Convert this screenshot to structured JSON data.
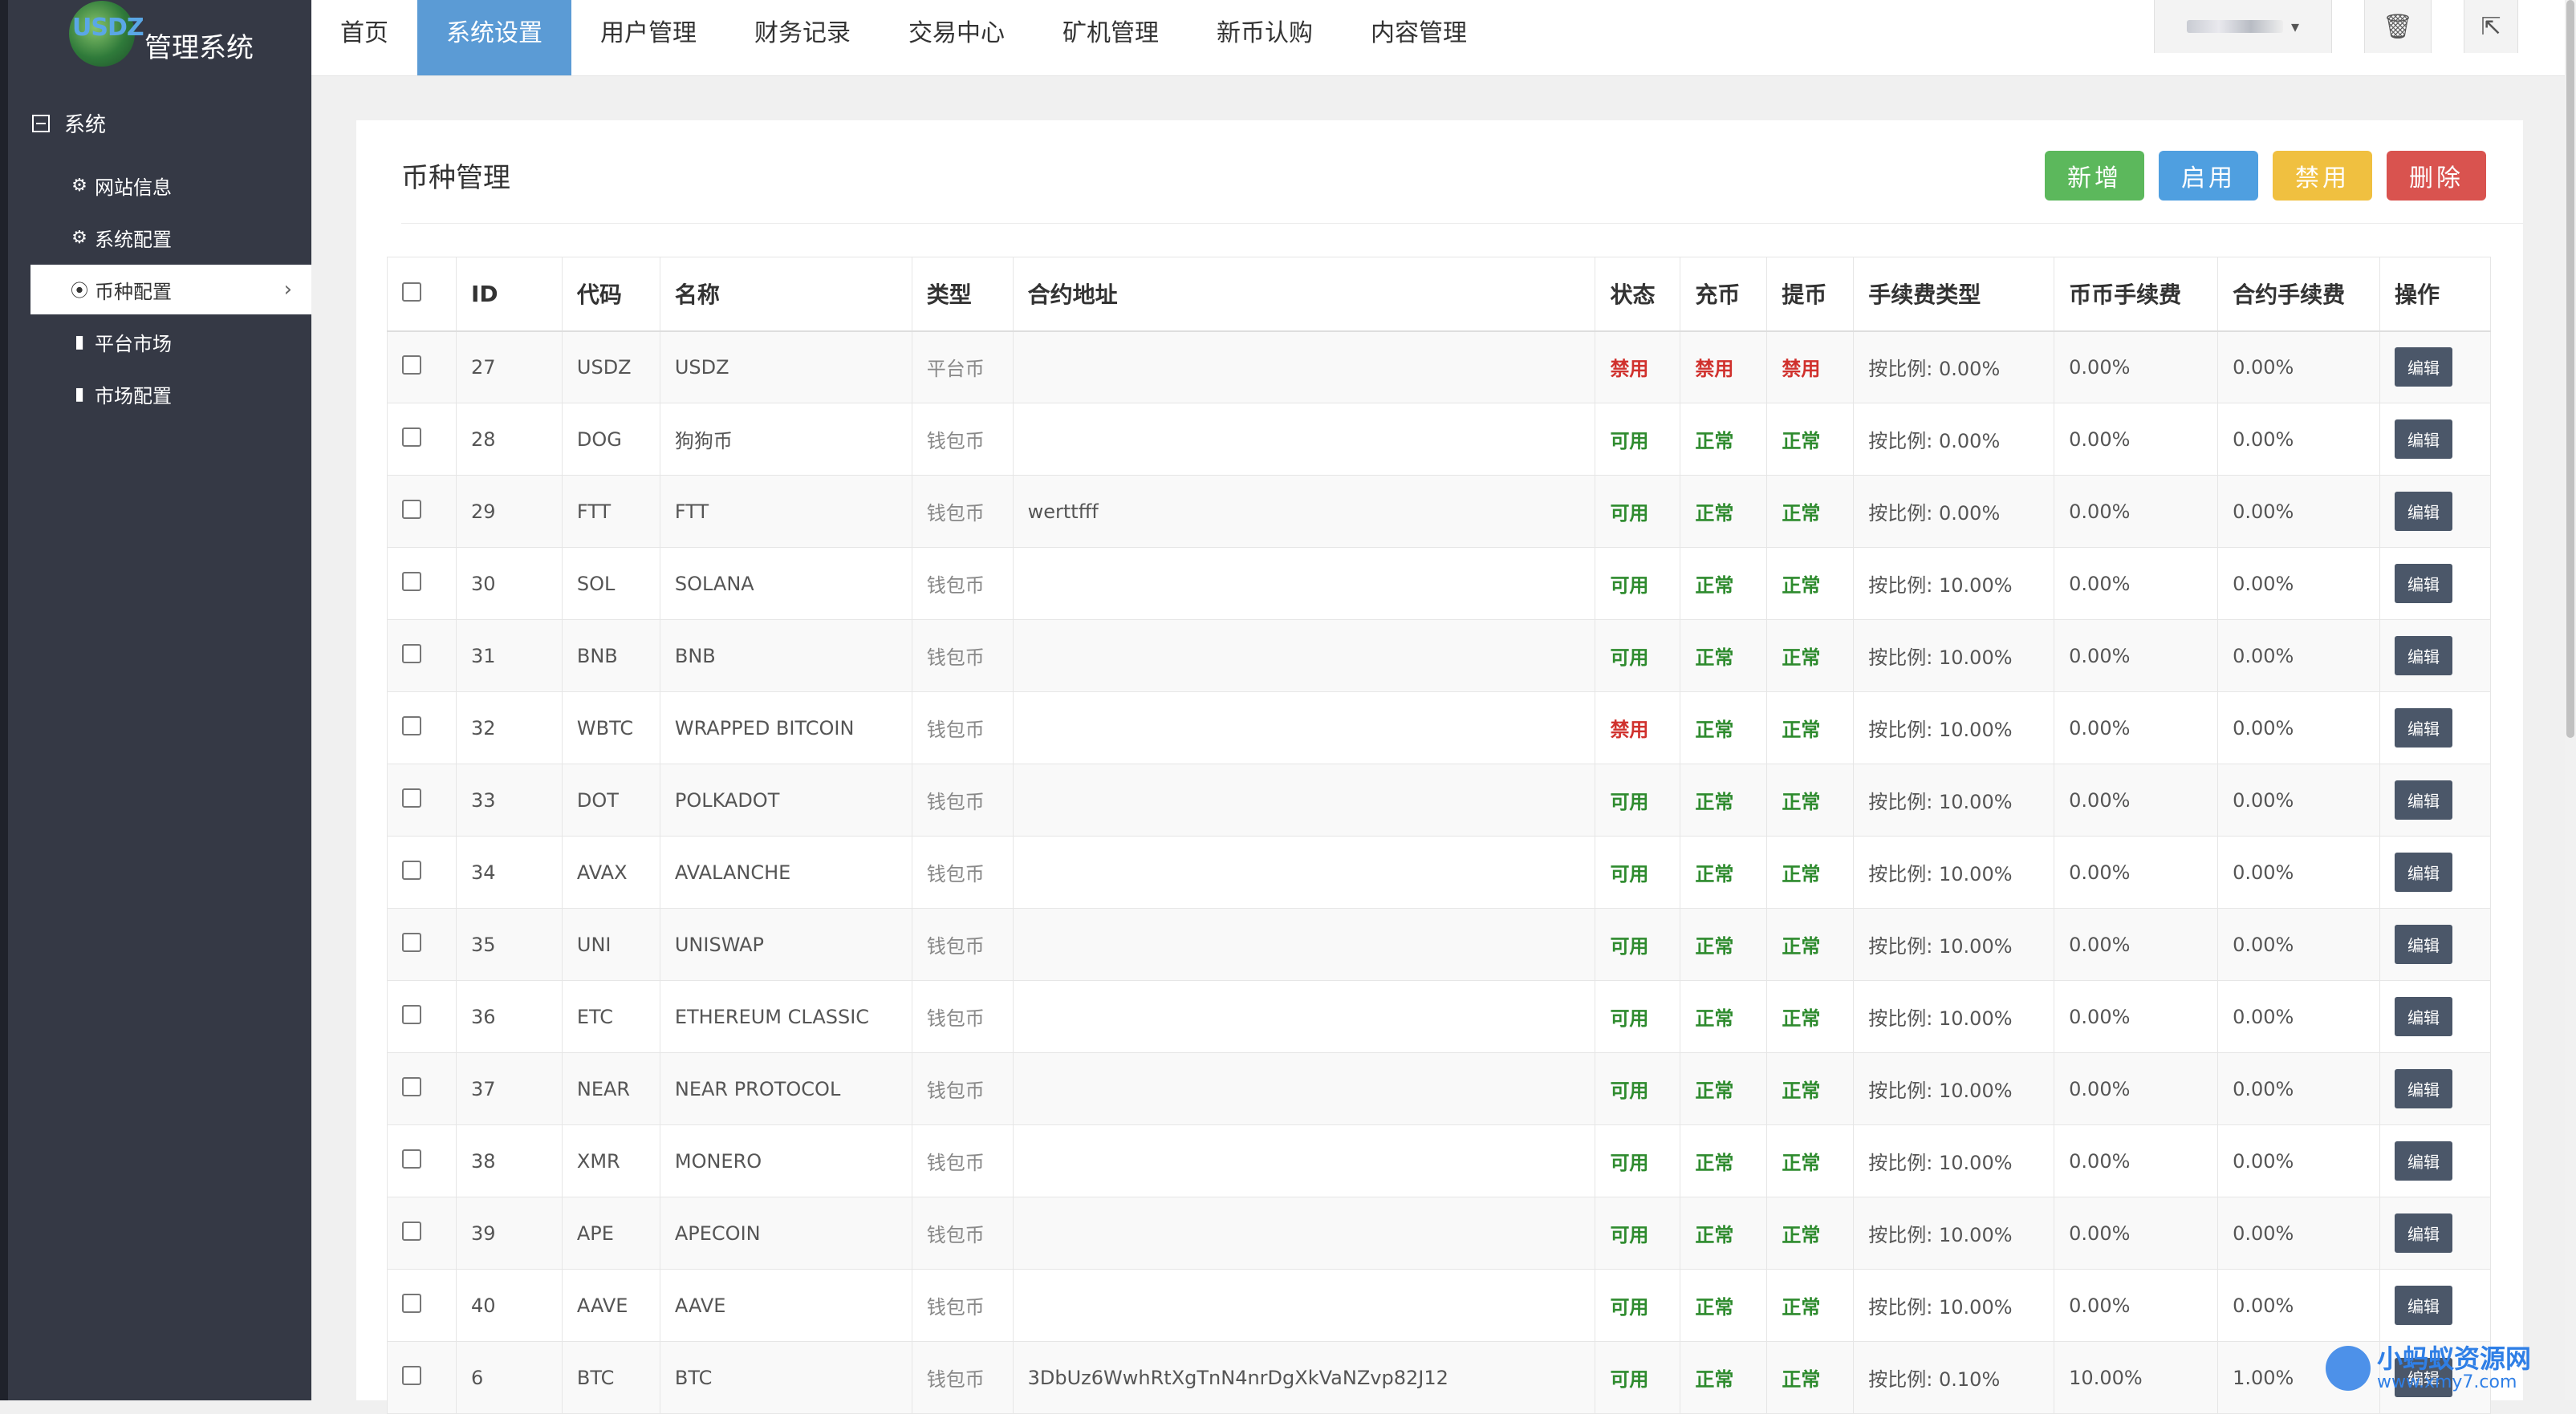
{
  "app": {
    "logo_text": "USDZ",
    "title": "管理系统"
  },
  "nav": {
    "items": [
      {
        "label": "首页",
        "active": false
      },
      {
        "label": "系统设置",
        "active": true
      },
      {
        "label": "用户管理",
        "active": false
      },
      {
        "label": "财务记录",
        "active": false
      },
      {
        "label": "交易中心",
        "active": false
      },
      {
        "label": "矿机管理",
        "active": false
      },
      {
        "label": "新币认购",
        "active": false
      },
      {
        "label": "内容管理",
        "active": false
      }
    ]
  },
  "topright": {
    "trash_icon": "trash-icon",
    "exit_icon": "exit-icon"
  },
  "sidebar": {
    "group": "系统",
    "items": [
      {
        "label": "网站信息",
        "icon": "gear-icon",
        "active": false
      },
      {
        "label": "系统配置",
        "icon": "gear-icon",
        "active": false
      },
      {
        "label": "币种配置",
        "icon": "dot-circle-icon",
        "active": true
      },
      {
        "label": "平台市场",
        "icon": "bar-chart-icon",
        "active": false
      },
      {
        "label": "市场配置",
        "icon": "bar-chart-icon",
        "active": false
      }
    ]
  },
  "panel": {
    "title": "币种管理",
    "actions": {
      "add": "新增",
      "enable": "启用",
      "disable": "禁用",
      "delete": "删除"
    }
  },
  "table": {
    "headers": [
      "ID",
      "代码",
      "名称",
      "类型",
      "合约地址",
      "状态",
      "充币",
      "提币",
      "手续费类型",
      "币币手续费",
      "合约手续费",
      "操作"
    ],
    "edit_label": "编辑",
    "rows": [
      [
        "27",
        "USDZ",
        "USDZ",
        "平台币",
        "",
        "禁用",
        "禁用",
        "禁用",
        "按比例: 0.00%",
        "0.00%",
        "0.00%"
      ],
      [
        "28",
        "DOG",
        "狗狗币",
        "钱包币",
        "",
        "可用",
        "正常",
        "正常",
        "按比例: 0.00%",
        "0.00%",
        "0.00%"
      ],
      [
        "29",
        "FTT",
        "FTT",
        "钱包币",
        "werttfff",
        "可用",
        "正常",
        "正常",
        "按比例: 0.00%",
        "0.00%",
        "0.00%"
      ],
      [
        "30",
        "SOL",
        "SOLANA",
        "钱包币",
        "",
        "可用",
        "正常",
        "正常",
        "按比例: 10.00%",
        "0.00%",
        "0.00%"
      ],
      [
        "31",
        "BNB",
        "BNB",
        "钱包币",
        "",
        "可用",
        "正常",
        "正常",
        "按比例: 10.00%",
        "0.00%",
        "0.00%"
      ],
      [
        "32",
        "WBTC",
        "WRAPPED BITCOIN",
        "钱包币",
        "",
        "禁用",
        "正常",
        "正常",
        "按比例: 10.00%",
        "0.00%",
        "0.00%"
      ],
      [
        "33",
        "DOT",
        "POLKADOT",
        "钱包币",
        "",
        "可用",
        "正常",
        "正常",
        "按比例: 10.00%",
        "0.00%",
        "0.00%"
      ],
      [
        "34",
        "AVAX",
        "AVALANCHE",
        "钱包币",
        "",
        "可用",
        "正常",
        "正常",
        "按比例: 10.00%",
        "0.00%",
        "0.00%"
      ],
      [
        "35",
        "UNI",
        "UNISWAP",
        "钱包币",
        "",
        "可用",
        "正常",
        "正常",
        "按比例: 10.00%",
        "0.00%",
        "0.00%"
      ],
      [
        "36",
        "ETC",
        "ETHEREUM CLASSIC",
        "钱包币",
        "",
        "可用",
        "正常",
        "正常",
        "按比例: 10.00%",
        "0.00%",
        "0.00%"
      ],
      [
        "37",
        "NEAR",
        "NEAR PROTOCOL",
        "钱包币",
        "",
        "可用",
        "正常",
        "正常",
        "按比例: 10.00%",
        "0.00%",
        "0.00%"
      ],
      [
        "38",
        "XMR",
        "MONERO",
        "钱包币",
        "",
        "可用",
        "正常",
        "正常",
        "按比例: 10.00%",
        "0.00%",
        "0.00%"
      ],
      [
        "39",
        "APE",
        "APECOIN",
        "钱包币",
        "",
        "可用",
        "正常",
        "正常",
        "按比例: 10.00%",
        "0.00%",
        "0.00%"
      ],
      [
        "40",
        "AAVE",
        "AAVE",
        "钱包币",
        "",
        "可用",
        "正常",
        "正常",
        "按比例: 10.00%",
        "0.00%",
        "0.00%"
      ],
      [
        "6",
        "BTC",
        "BTC",
        "钱包币",
        "3DbUz6WwhRtXgTnN4nrDgXkVaNZvp82J12",
        "可用",
        "正常",
        "正常",
        "按比例: 0.10%",
        "10.00%",
        "1.00%"
      ]
    ]
  },
  "watermark": {
    "line1": "小蚂蚁资源网",
    "line2": "www.xmy7.com"
  },
  "colors": {
    "sidebar": "#353945",
    "nav_active": "#5b9bd5",
    "status_red": "#d0312d",
    "status_green": "#2e8b2e"
  }
}
